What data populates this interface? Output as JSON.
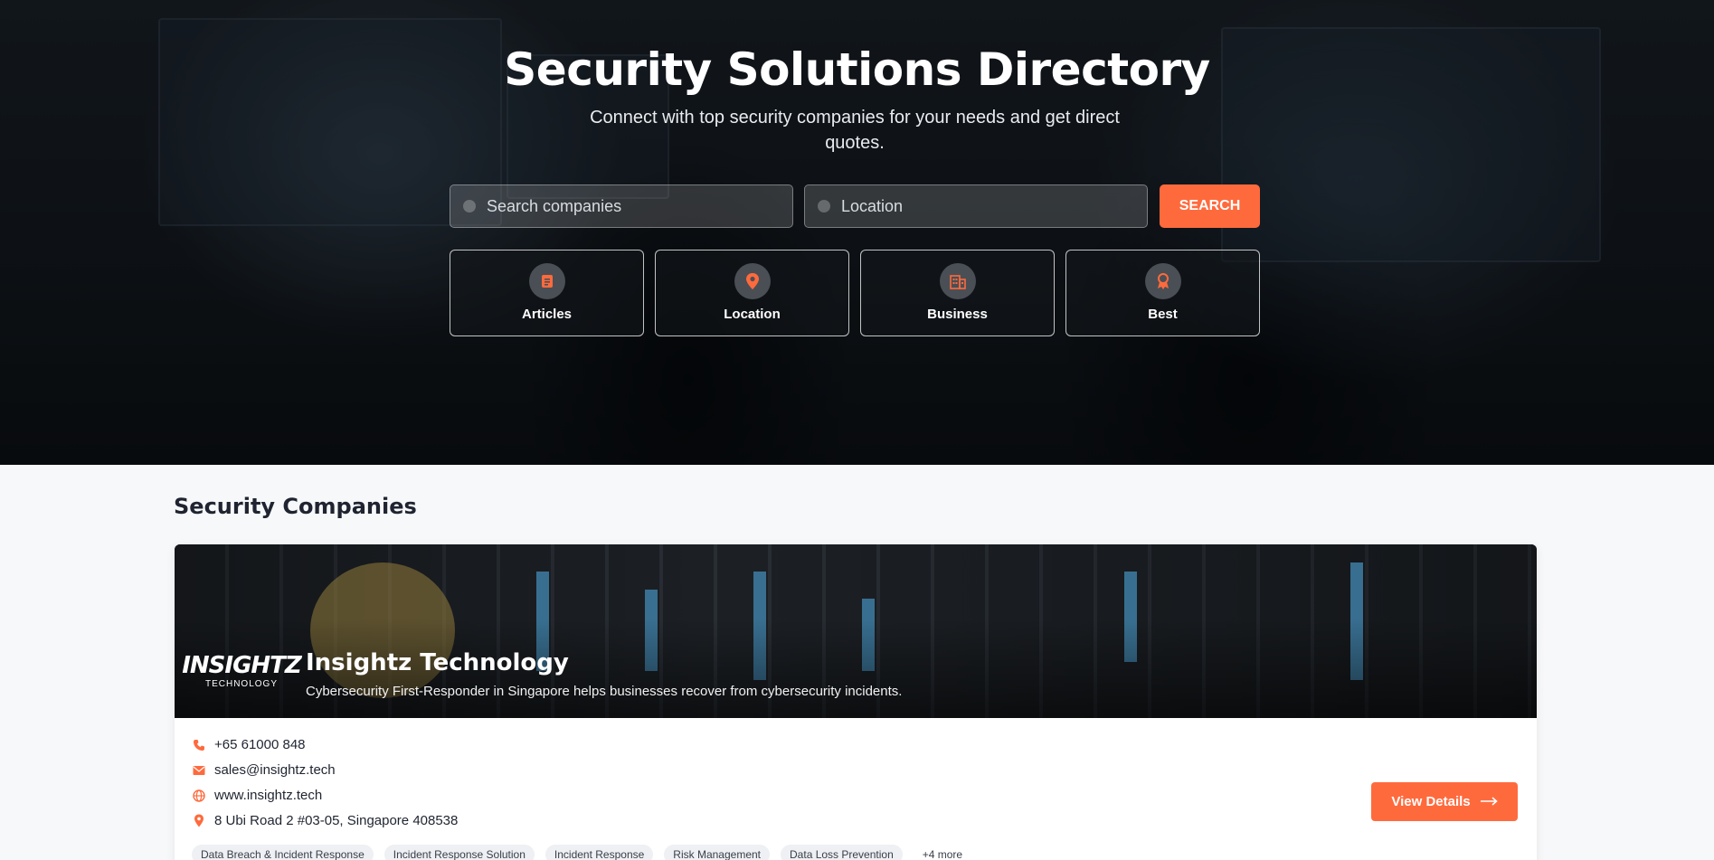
{
  "hero": {
    "title": "Security Solutions Directory",
    "subtitle": "Connect with top security companies for your needs and get direct quotes.",
    "search_placeholder": "Search companies",
    "location_placeholder": "Location",
    "search_button": "SEARCH",
    "categories": [
      {
        "label": "Articles",
        "icon": "document-icon"
      },
      {
        "label": "Location",
        "icon": "map-pin-icon"
      },
      {
        "label": "Business",
        "icon": "building-icon"
      },
      {
        "label": "Best",
        "icon": "award-icon"
      }
    ]
  },
  "section": {
    "title": "Security Companies"
  },
  "company": {
    "logo_line1": "INSIGHTZ",
    "logo_line2": "TECHNOLOGY",
    "name": "Insightz Technology",
    "description": "Cybersecurity First-Responder in Singapore helps businesses recover from cybersecurity incidents.",
    "phone": "+65 61000 848",
    "email": "sales@insightz.tech",
    "website": "www.insightz.tech",
    "address": "8 Ubi Road 2 #03-05, Singapore 408538",
    "details_button": "View Details",
    "tags": [
      "Data Breach & Incident Response",
      "Incident Response Solution",
      "Incident Response",
      "Risk Management",
      "Data Loss Prevention"
    ],
    "more_tags": "+4 more"
  },
  "colors": {
    "accent": "#ff6a3d",
    "hero_dark": "#141a20"
  }
}
